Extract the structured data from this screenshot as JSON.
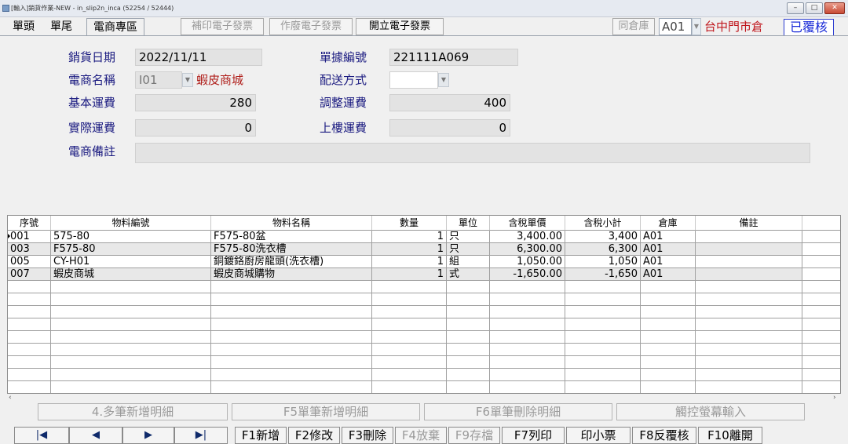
{
  "window": {
    "title": "[輸入]銷貨作業-NEW - in_slip2n_inca   (52254 / 52444)",
    "controls": [
      "–",
      "□",
      "✕"
    ]
  },
  "tabs": [
    {
      "label": "單頭"
    },
    {
      "label": "單尾"
    },
    {
      "label": "電商專區"
    }
  ],
  "toolbar": {
    "reprint_einvoice": "補印電子發票",
    "void_einvoice": "作廢電子發票",
    "issue_einvoice": "開立電子發票",
    "same_warehouse": "同倉庫",
    "warehouse_code": "A01",
    "warehouse_name": "台中門市倉",
    "status": "已覆核"
  },
  "form": {
    "sales_date_label": "銷貨日期",
    "sales_date": "2022/11/11",
    "doc_no_label": "單據編號",
    "doc_no": "221111A069",
    "ec_name_label": "電商名稱",
    "ec_code": "I01",
    "ec_name": "蝦皮商城",
    "delivery_label": "配送方式",
    "delivery": "",
    "base_freight_label": "基本運費",
    "base_freight": "280",
    "adjust_freight_label": "調整運費",
    "adjust_freight": "400",
    "actual_freight_label": "實際運費",
    "actual_freight": "0",
    "upstairs_freight_label": "上樓運費",
    "upstairs_freight": "0",
    "ec_note_label": "電商備註",
    "ec_note": ""
  },
  "grid": {
    "headers": [
      "序號",
      "物料編號",
      "物料名稱",
      "數量",
      "單位",
      "含稅單價",
      "含稅小計",
      "倉庫",
      "備註"
    ],
    "rows": [
      [
        "001",
        "575-80",
        "F575-80盆",
        "1",
        "只",
        "3,400.00",
        "3,400",
        "A01",
        ""
      ],
      [
        "003",
        "F575-80",
        "F575-80洗衣槽",
        "1",
        "只",
        "6,300.00",
        "6,300",
        "A01",
        ""
      ],
      [
        "005",
        "CY-H01",
        "銅鍍鉻廚房龍頭(洗衣槽)",
        "1",
        "組",
        "1,050.00",
        "1,050",
        "A01",
        ""
      ],
      [
        "007",
        "蝦皮商城",
        "蝦皮商城購物",
        "1",
        "式",
        "-1,650.00",
        "-1,650",
        "A01",
        ""
      ]
    ]
  },
  "actions": {
    "multi_add": "4.多筆新增明細",
    "single_add": "F5單筆新增明細",
    "delete_detail": "F6單筆刪除明細",
    "touch_input": "觸控螢幕輸入"
  },
  "nav": {
    "first": "|◀",
    "prev": "◀",
    "next": "▶",
    "last": "▶|"
  },
  "fkeys": {
    "f1": "F1新增",
    "f2": "F2修改",
    "f3": "F3刪除",
    "f4": "F4放棄",
    "f9": "F9存檔",
    "f7": "F7列印",
    "receipt": "印小票",
    "f8": "F8反覆核",
    "f10": "F10離開"
  },
  "colors": {
    "label_text": "#1a1a80",
    "warehouse_name": "#c0171d",
    "status_border": "#2a3bd0"
  }
}
